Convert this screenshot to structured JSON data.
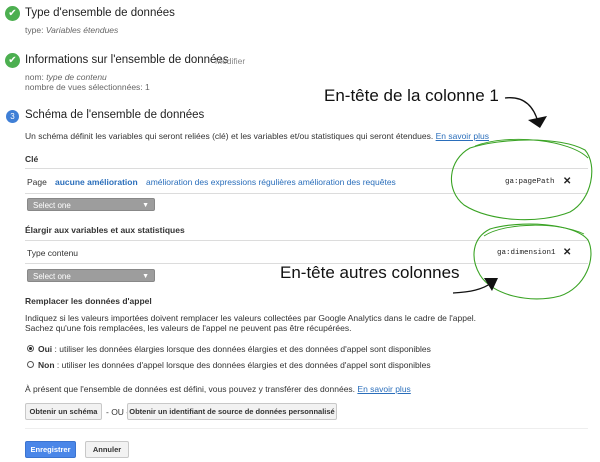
{
  "step1": {
    "title": "Type d'ensemble de données",
    "type_label": "type:",
    "type_value": "Variables étendues"
  },
  "step2": {
    "title": "Informations sur l'ensemble de données",
    "edit_label": "Modifier",
    "name_label": "nom:",
    "name_value": "type de contenu",
    "views_text": "nombre de vues sélectionnées: 1"
  },
  "step3": {
    "number": "3",
    "title": "Schéma de l'ensemble de données",
    "description": "Un schéma définit les variables qui seront reliées (clé) et les variables et/ou statistiques qui seront étendues.",
    "learn_more": "En savoir plus"
  },
  "key_section": {
    "heading": "Clé",
    "row_label": "Page",
    "options": [
      "aucune amélioration",
      "amélioration des expressions régulières",
      "amélioration des requêtes"
    ],
    "code": "ga:pagePath",
    "select_placeholder": "Select one"
  },
  "extend_section": {
    "heading": "Élargir aux variables et aux statistiques",
    "row_label": "Type contenu",
    "code": "ga:dimension1",
    "select_placeholder": "Select one"
  },
  "replace_section": {
    "heading": "Remplacer les données d'appel",
    "desc1": "Indiquez si les valeurs importées doivent remplacer les valeurs collectées par Google Analytics dans le cadre de l'appel.",
    "desc2": "Sachez qu'une fois remplacées, les valeurs de l'appel ne peuvent pas être récupérées.",
    "yes_label": "Oui",
    "yes_text": ": utiliser les données élargies lorsque des données élargies et des données d'appel sont disponibles",
    "no_label": "Non",
    "no_text": ": utiliser les données d'appel lorsque des données élargies et des données d'appel sont disponibles",
    "selected": "yes"
  },
  "transfer": {
    "text": "À présent que l'ensemble de données est défini, vous pouvez y transférer des données.",
    "learn_more": "En savoir plus",
    "get_schema": "Obtenir un schéma",
    "or_text": "- OU -",
    "get_id": "Obtenir un identifiant de source de données personnalisé"
  },
  "footer": {
    "save": "Enregistrer",
    "cancel": "Annuler"
  },
  "annotations": {
    "col1": "En-tête de la colonne 1",
    "others": "En-tête autres colonnes"
  },
  "colors": {
    "check": "#4caf50",
    "link": "#2a6ebb",
    "primary": "#4a86e8",
    "annotation_circle": "#3aa324"
  },
  "close_symbol": "✕"
}
